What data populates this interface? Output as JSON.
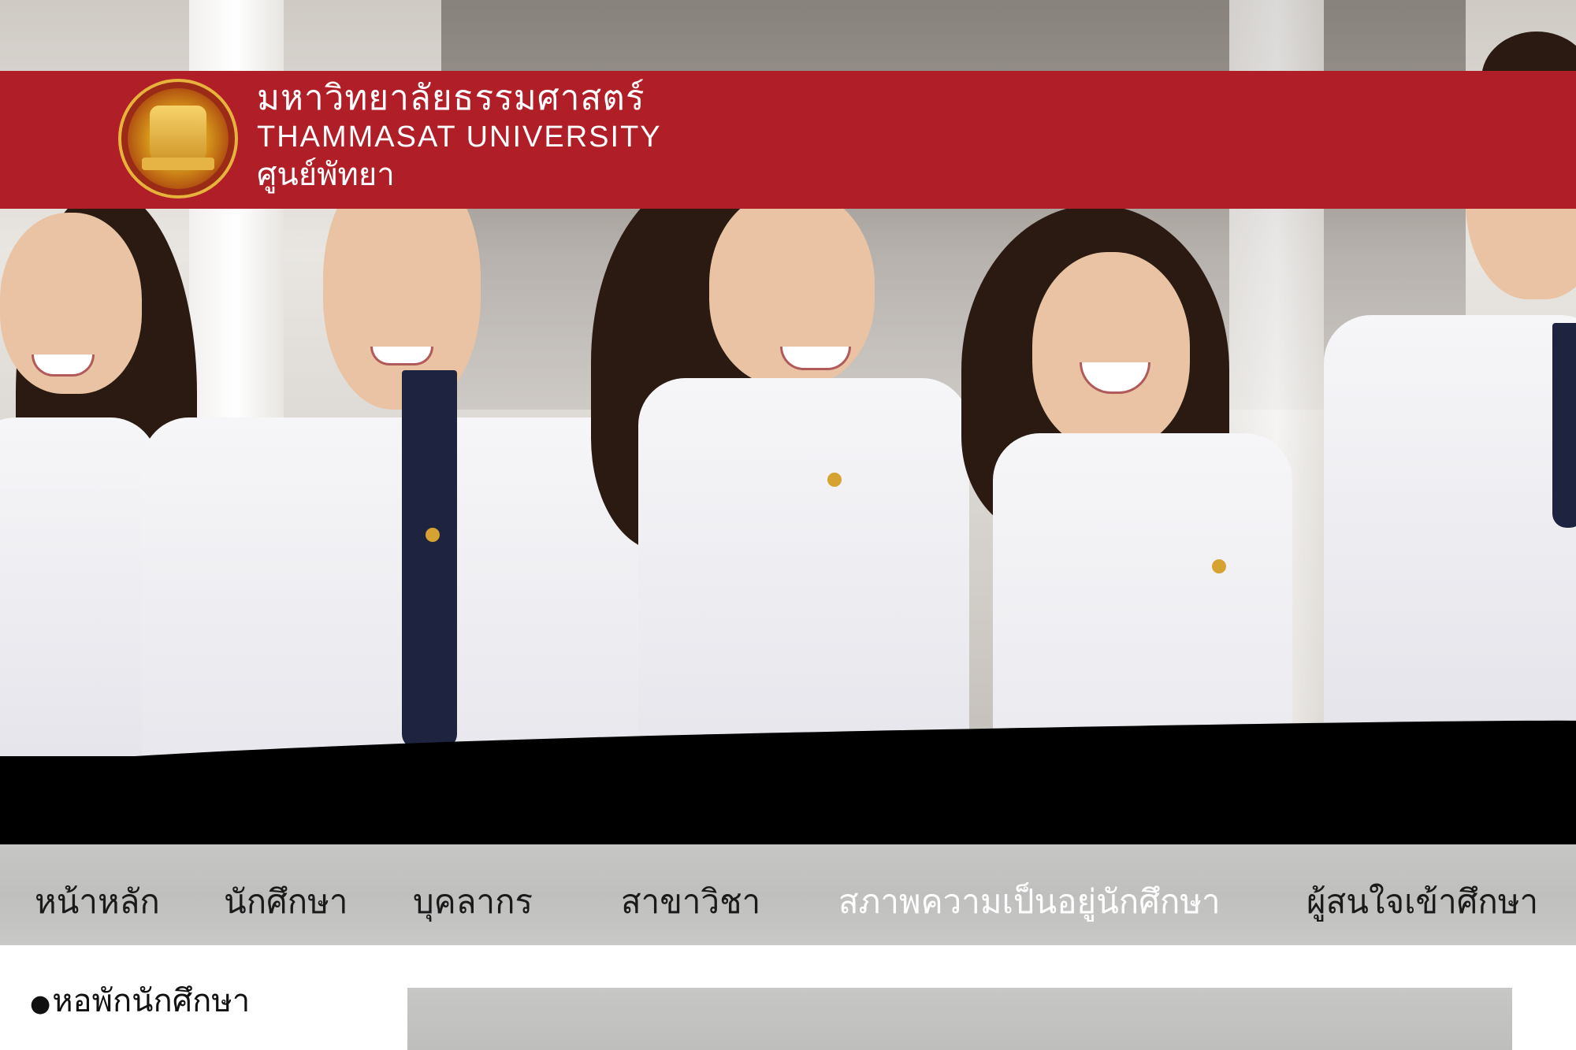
{
  "header": {
    "university_name_th": "มหาวิทยาลัยธรรมศาสตร์",
    "university_name_en": "THAMMASAT UNIVERSITY",
    "campus": "ศูนย์พัทยา",
    "logo_icon": "thammasat-seal-icon",
    "bar_color": "#b01f27"
  },
  "nav": {
    "items": [
      {
        "label": "หน้าหลัก",
        "active": false
      },
      {
        "label": "นักศึกษา",
        "active": false
      },
      {
        "label": "บุคลากร",
        "active": false
      },
      {
        "label": "สาขาวิชา",
        "active": false
      },
      {
        "label": "สภาพความเป็นอยู่นักศึกษา",
        "active": true
      },
      {
        "label": "ผู้สนใจเข้าศึกษา",
        "active": false
      }
    ],
    "background_color": "#c4c5c3",
    "active_color": "#ffffff"
  },
  "sidebar": {
    "items": [
      {
        "bullet": "●",
        "label": "หอพักนักศึกษา"
      }
    ]
  }
}
